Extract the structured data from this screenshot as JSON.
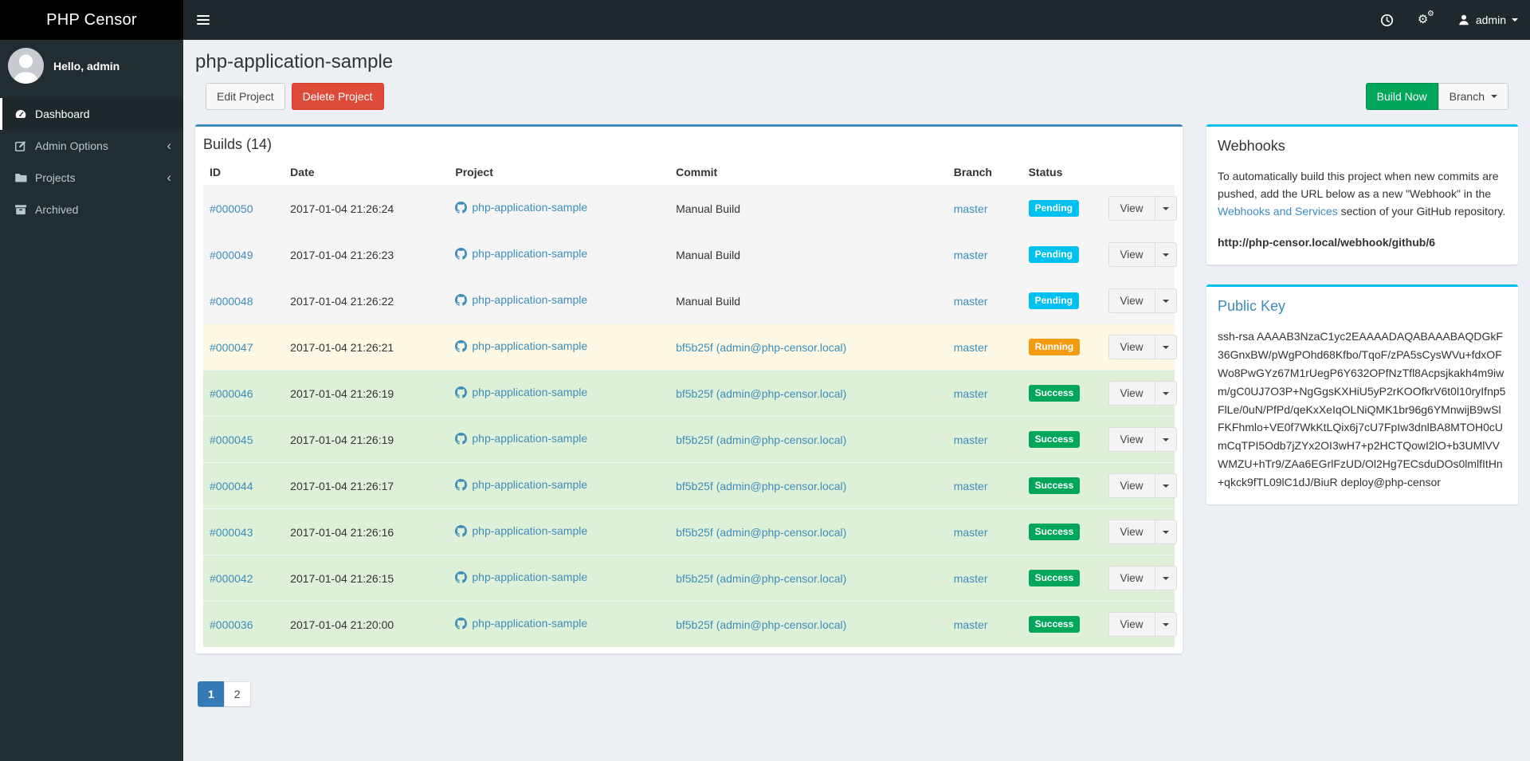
{
  "app": {
    "brand": "PHP Censor"
  },
  "navbar": {
    "user": "admin"
  },
  "sidebar": {
    "greeting": "Hello, admin",
    "items": [
      {
        "label": "Dashboard",
        "icon": "gauge-icon",
        "active": true,
        "chevron": false
      },
      {
        "label": "Admin Options",
        "icon": "edit-icon",
        "active": false,
        "chevron": true
      },
      {
        "label": "Projects",
        "icon": "folder-icon",
        "active": false,
        "chevron": true
      },
      {
        "label": "Archived",
        "icon": "archive-icon",
        "active": false,
        "chevron": false
      }
    ]
  },
  "page": {
    "title": "php-application-sample",
    "edit_button": "Edit Project",
    "delete_button": "Delete Project",
    "build_now_button": "Build Now",
    "branch_button": "Branch"
  },
  "builds": {
    "title": "Builds (14)",
    "columns": [
      "ID",
      "Date",
      "Project",
      "Commit",
      "Branch",
      "Status"
    ],
    "view_label": "View",
    "rows": [
      {
        "id": "#000050",
        "date": "2017-01-04 21:26:24",
        "project": "php-application-sample",
        "commit": "Manual Build",
        "commit_link": false,
        "branch": "master",
        "status": "Pending"
      },
      {
        "id": "#000049",
        "date": "2017-01-04 21:26:23",
        "project": "php-application-sample",
        "commit": "Manual Build",
        "commit_link": false,
        "branch": "master",
        "status": "Pending"
      },
      {
        "id": "#000048",
        "date": "2017-01-04 21:26:22",
        "project": "php-application-sample",
        "commit": "Manual Build",
        "commit_link": false,
        "branch": "master",
        "status": "Pending"
      },
      {
        "id": "#000047",
        "date": "2017-01-04 21:26:21",
        "project": "php-application-sample",
        "commit": "bf5b25f (admin@php-censor.local)",
        "commit_link": true,
        "branch": "master",
        "status": "Running"
      },
      {
        "id": "#000046",
        "date": "2017-01-04 21:26:19",
        "project": "php-application-sample",
        "commit": "bf5b25f (admin@php-censor.local)",
        "commit_link": true,
        "branch": "master",
        "status": "Success"
      },
      {
        "id": "#000045",
        "date": "2017-01-04 21:26:19",
        "project": "php-application-sample",
        "commit": "bf5b25f (admin@php-censor.local)",
        "commit_link": true,
        "branch": "master",
        "status": "Success"
      },
      {
        "id": "#000044",
        "date": "2017-01-04 21:26:17",
        "project": "php-application-sample",
        "commit": "bf5b25f (admin@php-censor.local)",
        "commit_link": true,
        "branch": "master",
        "status": "Success"
      },
      {
        "id": "#000043",
        "date": "2017-01-04 21:26:16",
        "project": "php-application-sample",
        "commit": "bf5b25f (admin@php-censor.local)",
        "commit_link": true,
        "branch": "master",
        "status": "Success"
      },
      {
        "id": "#000042",
        "date": "2017-01-04 21:26:15",
        "project": "php-application-sample",
        "commit": "bf5b25f (admin@php-censor.local)",
        "commit_link": true,
        "branch": "master",
        "status": "Success"
      },
      {
        "id": "#000036",
        "date": "2017-01-04 21:20:00",
        "project": "php-application-sample",
        "commit": "bf5b25f (admin@php-censor.local)",
        "commit_link": true,
        "branch": "master",
        "status": "Success"
      }
    ]
  },
  "pagination": [
    {
      "label": "1",
      "active": true
    },
    {
      "label": "2",
      "active": false
    }
  ],
  "webhooks": {
    "title": "Webhooks",
    "text_before_link": "To automatically build this project when new commits are pushed, add the URL below as a new \"Webhook\" in the ",
    "link_text": "Webhooks and Services",
    "text_after_link": " section of your GitHub repository.",
    "url": "http://php-censor.local/webhook/github/6"
  },
  "public_key": {
    "title": "Public Key",
    "key": "ssh-rsa AAAAB3NzaC1yc2EAAAADAQABAAABAQDGkF36GnxBW/pWgPOhd68Kfbo/TqoF/zPA5sCysWVu+fdxOFWo8PwGYz67M1rUegP6Y632OPfNzTfl8Acpsjkakh4m9iwm/gC0UJ7O3P+NgGgsKXHiU5yP2rKOOfkrV6t0l10ryIfnp5FlLe/0uN/PfPd/qeKxXeIqOLNiQMK1br96g6YMnwijB9wSlFKFhmlo+VE0f7WkKtLQix6j7cU7FpIw3dnlBA8MTOH0cUmCqTPI5Odb7jZYx2OI3wH7+p2HCTQowI2lO+b3UMlVVWMZU+hTr9/ZAa6EGrlFzUD/Ol2Hg7ECsduDOs0lmlfItHn+qkck9fTL09lC1dJ/BiuR deploy@php-censor"
  },
  "colors": {
    "accent_blue": "#3c8dbc",
    "info_cyan": "#00c0ef",
    "success_green": "#00a65a",
    "warning_orange": "#f39c12",
    "danger_red": "#dd4b39",
    "status": {
      "Pending": "#00c0ef",
      "Running": "#f39c12",
      "Success": "#00a65a"
    },
    "row_bg": {
      "Pending": "#f5f5f5",
      "Running": "#fcf8e3",
      "Success": "#dff0d8"
    }
  }
}
